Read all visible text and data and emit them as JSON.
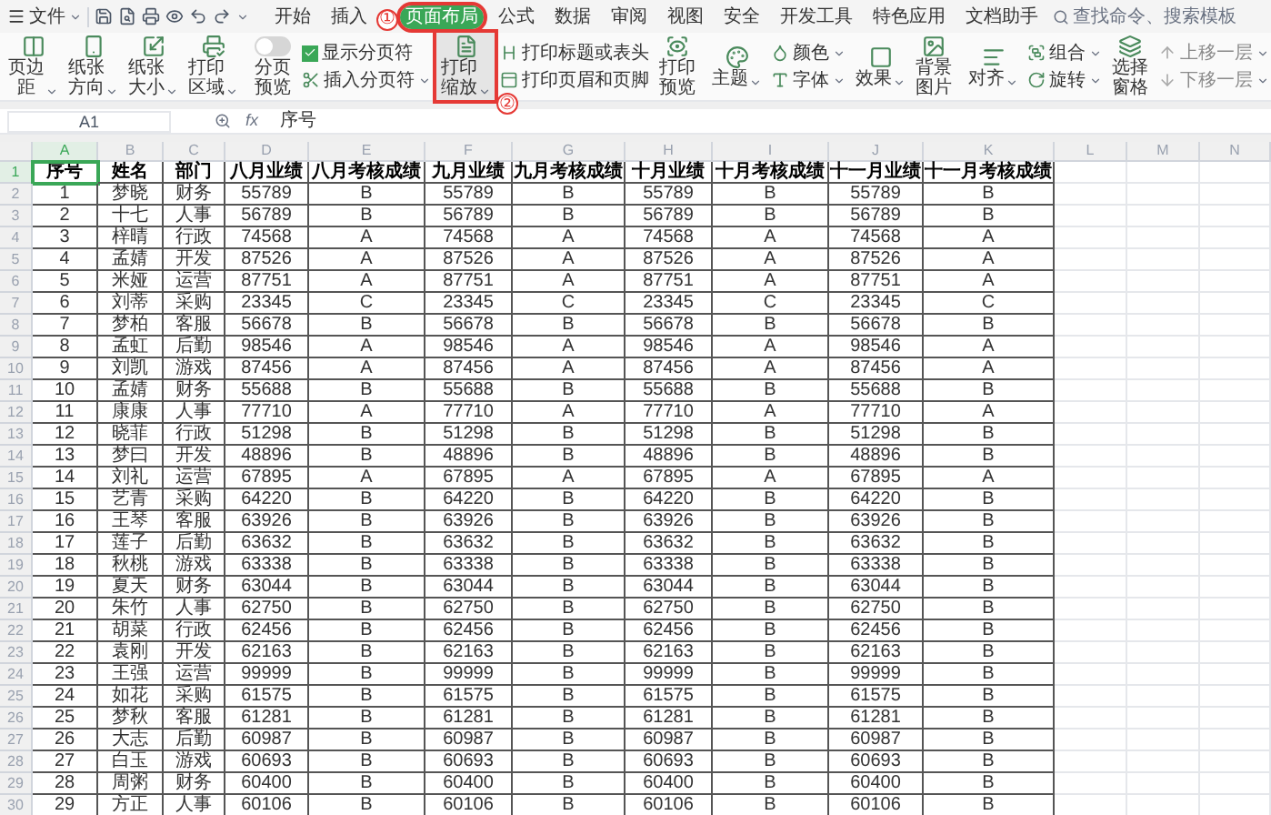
{
  "menu": {
    "label": "文件"
  },
  "tabs": [
    {
      "label": "开始",
      "selected": false,
      "highlighted": false
    },
    {
      "label": "插入",
      "selected": false,
      "highlighted": false
    },
    {
      "label": "页面布局",
      "selected": true,
      "highlighted": true,
      "marker": "①"
    },
    {
      "label": "公式",
      "selected": false,
      "highlighted": false
    },
    {
      "label": "数据",
      "selected": false,
      "highlighted": false
    },
    {
      "label": "审阅",
      "selected": false,
      "highlighted": false
    },
    {
      "label": "视图",
      "selected": false,
      "highlighted": false
    },
    {
      "label": "安全",
      "selected": false,
      "highlighted": false
    },
    {
      "label": "开发工具",
      "selected": false,
      "highlighted": false
    },
    {
      "label": "特色应用",
      "selected": false,
      "highlighted": false
    },
    {
      "label": "文档助手",
      "selected": false,
      "highlighted": false
    }
  ],
  "search": {
    "placeholder": "查找命令、搜索模板"
  },
  "ribbon": {
    "groups": [
      [
        {
          "kind": "large",
          "label": "页边距",
          "dropdown": true
        },
        {
          "kind": "large",
          "label": "纸张方向",
          "dropdown": true
        },
        {
          "kind": "large",
          "label": "纸张大小",
          "dropdown": true
        },
        {
          "kind": "large",
          "label": "打印区域",
          "dropdown": true
        }
      ],
      [
        {
          "kind": "toggle",
          "label": "分页预览",
          "on": false
        },
        {
          "kind": "stack",
          "items": [
            {
              "kind": "check",
              "label": "显示分页符",
              "checked": true,
              "dropdown": false,
              "disabled": false
            },
            {
              "kind": "plain",
              "label": "插入分页符",
              "dropdown": true,
              "disabled": false
            }
          ]
        },
        {
          "kind": "large",
          "label": "打印缩放",
          "dropdown": true,
          "highlighted": true,
          "marker": "②"
        },
        {
          "kind": "stack",
          "items": [
            {
              "kind": "plain",
              "label": "打印标题或表头",
              "dropdown": false,
              "disabled": false
            },
            {
              "kind": "plain",
              "label": "打印页眉和页脚",
              "dropdown": false,
              "disabled": false
            }
          ]
        },
        {
          "kind": "large",
          "label": "打印预览",
          "dropdown": false
        }
      ],
      [
        {
          "kind": "large",
          "label": "主题",
          "dropdown": true
        },
        {
          "kind": "stack",
          "items": [
            {
              "kind": "plain",
              "label": "颜色",
              "dropdown": true,
              "disabled": false
            },
            {
              "kind": "plain",
              "label": "字体",
              "dropdown": true,
              "disabled": false
            }
          ]
        },
        {
          "kind": "large",
          "label": "效果",
          "dropdown": true
        },
        {
          "kind": "large",
          "label": "背景图片",
          "dropdown": false
        }
      ],
      [
        {
          "kind": "large",
          "label": "对齐",
          "dropdown": true
        },
        {
          "kind": "stack",
          "items": [
            {
              "kind": "plain",
              "label": "组合",
              "dropdown": true,
              "disabled": false
            },
            {
              "kind": "plain",
              "label": "旋转",
              "dropdown": true,
              "disabled": false
            }
          ]
        },
        {
          "kind": "large",
          "label": "选择窗格",
          "dropdown": false
        },
        {
          "kind": "stack",
          "items": [
            {
              "kind": "plain",
              "label": "上移一层",
              "dropdown": true,
              "disabled": true
            },
            {
              "kind": "plain",
              "label": "下移一层",
              "dropdown": true,
              "disabled": true
            }
          ]
        }
      ]
    ]
  },
  "formula_bar": {
    "cell": "A1",
    "function_label": "fx",
    "value": "序号"
  },
  "sheet": {
    "columns": [
      {
        "label": "A",
        "selected": true
      },
      {
        "label": "B",
        "selected": false
      },
      {
        "label": "C",
        "selected": false
      },
      {
        "label": "D",
        "selected": false
      },
      {
        "label": "E",
        "selected": false
      },
      {
        "label": "F",
        "selected": false
      },
      {
        "label": "G",
        "selected": false
      },
      {
        "label": "H",
        "selected": false
      },
      {
        "label": "I",
        "selected": false
      },
      {
        "label": "J",
        "selected": false
      },
      {
        "label": "K",
        "selected": false
      },
      {
        "label": "L",
        "selected": false
      },
      {
        "label": "M",
        "selected": false
      },
      {
        "label": "N",
        "selected": false
      }
    ],
    "rows": [
      {
        "number": "1",
        "selected": true,
        "kind": "header",
        "cells": [
          "序号",
          "姓名",
          "部门",
          "八月业绩",
          "八月考核成绩",
          "九月业绩",
          "九月考核成绩",
          "十月业绩",
          "十月考核成绩",
          "十一月业绩",
          "十一月考核成绩"
        ]
      },
      {
        "number": "2",
        "selected": false,
        "kind": "data",
        "cells": [
          "1",
          "梦晓",
          "财务",
          "55789",
          "B",
          "55789",
          "B",
          "55789",
          "B",
          "55789",
          "B"
        ]
      },
      {
        "number": "3",
        "selected": false,
        "kind": "data",
        "cells": [
          "2",
          "十七",
          "人事",
          "56789",
          "B",
          "56789",
          "B",
          "56789",
          "B",
          "56789",
          "B"
        ]
      },
      {
        "number": "4",
        "selected": false,
        "kind": "data",
        "cells": [
          "3",
          "梓晴",
          "行政",
          "74568",
          "A",
          "74568",
          "A",
          "74568",
          "A",
          "74568",
          "A"
        ]
      },
      {
        "number": "5",
        "selected": false,
        "kind": "data",
        "cells": [
          "4",
          "孟婧",
          "开发",
          "87526",
          "A",
          "87526",
          "A",
          "87526",
          "A",
          "87526",
          "A"
        ]
      },
      {
        "number": "6",
        "selected": false,
        "kind": "data",
        "cells": [
          "5",
          "米娅",
          "运营",
          "87751",
          "A",
          "87751",
          "A",
          "87751",
          "A",
          "87751",
          "A"
        ]
      },
      {
        "number": "7",
        "selected": false,
        "kind": "data",
        "cells": [
          "6",
          "刘蒂",
          "采购",
          "23345",
          "C",
          "23345",
          "C",
          "23345",
          "C",
          "23345",
          "C"
        ]
      },
      {
        "number": "8",
        "selected": false,
        "kind": "data",
        "cells": [
          "7",
          "梦柏",
          "客服",
          "56678",
          "B",
          "56678",
          "B",
          "56678",
          "B",
          "56678",
          "B"
        ]
      },
      {
        "number": "9",
        "selected": false,
        "kind": "data",
        "cells": [
          "8",
          "孟虹",
          "后勤",
          "98546",
          "A",
          "98546",
          "A",
          "98546",
          "A",
          "98546",
          "A"
        ]
      },
      {
        "number": "10",
        "selected": false,
        "kind": "data",
        "cells": [
          "9",
          "刘凯",
          "游戏",
          "87456",
          "A",
          "87456",
          "A",
          "87456",
          "A",
          "87456",
          "A"
        ]
      },
      {
        "number": "11",
        "selected": false,
        "kind": "data",
        "cells": [
          "10",
          "孟婧",
          "财务",
          "55688",
          "B",
          "55688",
          "B",
          "55688",
          "B",
          "55688",
          "B"
        ]
      },
      {
        "number": "12",
        "selected": false,
        "kind": "data",
        "cells": [
          "11",
          "康康",
          "人事",
          "77710",
          "A",
          "77710",
          "A",
          "77710",
          "A",
          "77710",
          "A"
        ]
      },
      {
        "number": "13",
        "selected": false,
        "kind": "data",
        "cells": [
          "12",
          "晓菲",
          "行政",
          "51298",
          "B",
          "51298",
          "B",
          "51298",
          "B",
          "51298",
          "B"
        ]
      },
      {
        "number": "14",
        "selected": false,
        "kind": "data",
        "cells": [
          "13",
          "梦曰",
          "开发",
          "48896",
          "B",
          "48896",
          "B",
          "48896",
          "B",
          "48896",
          "B"
        ]
      },
      {
        "number": "15",
        "selected": false,
        "kind": "data",
        "cells": [
          "14",
          "刘礼",
          "运营",
          "67895",
          "A",
          "67895",
          "A",
          "67895",
          "A",
          "67895",
          "A"
        ]
      },
      {
        "number": "16",
        "selected": false,
        "kind": "data",
        "cells": [
          "15",
          "艺青",
          "采购",
          "64220",
          "B",
          "64220",
          "B",
          "64220",
          "B",
          "64220",
          "B"
        ]
      },
      {
        "number": "17",
        "selected": false,
        "kind": "data",
        "cells": [
          "16",
          "王琴",
          "客服",
          "63926",
          "B",
          "63926",
          "B",
          "63926",
          "B",
          "63926",
          "B"
        ]
      },
      {
        "number": "18",
        "selected": false,
        "kind": "data",
        "cells": [
          "17",
          "莲子",
          "后勤",
          "63632",
          "B",
          "63632",
          "B",
          "63632",
          "B",
          "63632",
          "B"
        ]
      },
      {
        "number": "19",
        "selected": false,
        "kind": "data",
        "cells": [
          "18",
          "秋桃",
          "游戏",
          "63338",
          "B",
          "63338",
          "B",
          "63338",
          "B",
          "63338",
          "B"
        ]
      },
      {
        "number": "20",
        "selected": false,
        "kind": "data",
        "cells": [
          "19",
          "夏天",
          "财务",
          "63044",
          "B",
          "63044",
          "B",
          "63044",
          "B",
          "63044",
          "B"
        ]
      },
      {
        "number": "21",
        "selected": false,
        "kind": "data",
        "cells": [
          "20",
          "朱竹",
          "人事",
          "62750",
          "B",
          "62750",
          "B",
          "62750",
          "B",
          "62750",
          "B"
        ]
      },
      {
        "number": "22",
        "selected": false,
        "kind": "data",
        "cells": [
          "21",
          "胡菜",
          "行政",
          "62456",
          "B",
          "62456",
          "B",
          "62456",
          "B",
          "62456",
          "B"
        ]
      },
      {
        "number": "23",
        "selected": false,
        "kind": "data",
        "cells": [
          "22",
          "袁刚",
          "开发",
          "62163",
          "B",
          "62163",
          "B",
          "62163",
          "B",
          "62163",
          "B"
        ]
      },
      {
        "number": "24",
        "selected": false,
        "kind": "data",
        "cells": [
          "23",
          "王强",
          "运营",
          "99999",
          "B",
          "99999",
          "B",
          "99999",
          "B",
          "99999",
          "B"
        ]
      },
      {
        "number": "25",
        "selected": false,
        "kind": "data",
        "cells": [
          "24",
          "如花",
          "采购",
          "61575",
          "B",
          "61575",
          "B",
          "61575",
          "B",
          "61575",
          "B"
        ]
      },
      {
        "number": "26",
        "selected": false,
        "kind": "data",
        "cells": [
          "25",
          "梦秋",
          "客服",
          "61281",
          "B",
          "61281",
          "B",
          "61281",
          "B",
          "61281",
          "B"
        ]
      },
      {
        "number": "27",
        "selected": false,
        "kind": "data",
        "cells": [
          "26",
          "大志",
          "后勤",
          "60987",
          "B",
          "60987",
          "B",
          "60987",
          "B",
          "60987",
          "B"
        ]
      },
      {
        "number": "28",
        "selected": false,
        "kind": "data",
        "cells": [
          "27",
          "白玉",
          "游戏",
          "60693",
          "B",
          "60693",
          "B",
          "60693",
          "B",
          "60693",
          "B"
        ]
      },
      {
        "number": "29",
        "selected": false,
        "kind": "data",
        "cells": [
          "28",
          "周粥",
          "财务",
          "60400",
          "B",
          "60400",
          "B",
          "60400",
          "B",
          "60400",
          "B"
        ]
      },
      {
        "number": "30",
        "selected": false,
        "kind": "data",
        "cells": [
          "29",
          "方正",
          "人事",
          "60106",
          "B",
          "60106",
          "B",
          "60106",
          "B",
          "60106",
          "B"
        ]
      }
    ]
  }
}
